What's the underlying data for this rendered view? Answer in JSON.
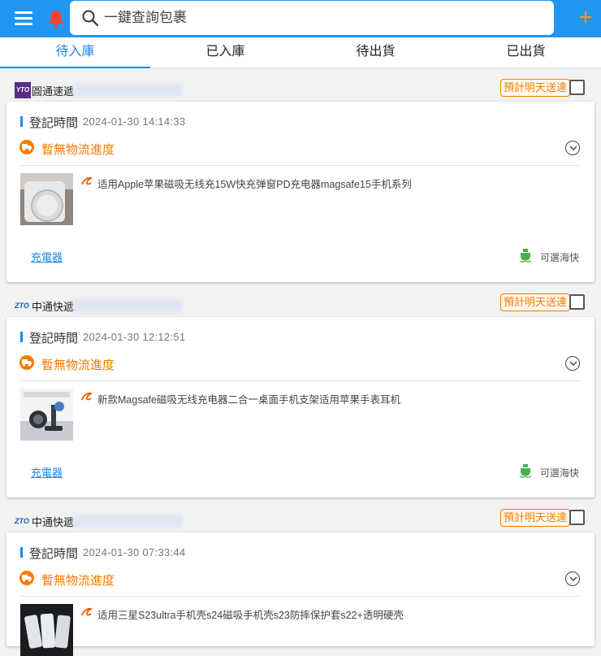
{
  "search": {
    "placeholder": "一鍵查詢包裹"
  },
  "tabs": [
    "待入庫",
    "已入庫",
    "待出貨",
    "已出貨"
  ],
  "packages": [
    {
      "carrier": "圓通速遞",
      "carrier_logo": "YTO",
      "eta_badge": "預計明天送達",
      "reg_label": "登記時間",
      "reg_time": "2024-01-30 14:14:33",
      "status": "暫無物流進度",
      "product_title": "适用Apple苹果磁吸无线充15W快充弹窗PD充电器magsafe15手机系列",
      "category": "充電器",
      "shipping_option": "可選海快"
    },
    {
      "carrier": "中通快遞",
      "carrier_logo": "ZTO",
      "eta_badge": "預計明天送達",
      "reg_label": "登記時間",
      "reg_time": "2024-01-30 12:12:51",
      "status": "暫無物流進度",
      "product_title": "新款Magsafe磁吸无线充电器二合一桌面手机支架适用苹果手表耳机",
      "category": "充電器",
      "shipping_option": "可選海快"
    },
    {
      "carrier": "中通快遞",
      "carrier_logo": "ZTO",
      "eta_badge": "預計明天送達",
      "reg_label": "登記時間",
      "reg_time": "2024-01-30 07:33:44",
      "status": "暫無物流進度",
      "product_title": "适用三星S23ultra手机壳s24磁吸手机壳s23防摔保护套s22+透明硬壳"
    }
  ],
  "colors": {
    "header": "#2196f3",
    "accent": "#1e88e5",
    "warning": "#f57c00",
    "ship": "#4caf50"
  }
}
